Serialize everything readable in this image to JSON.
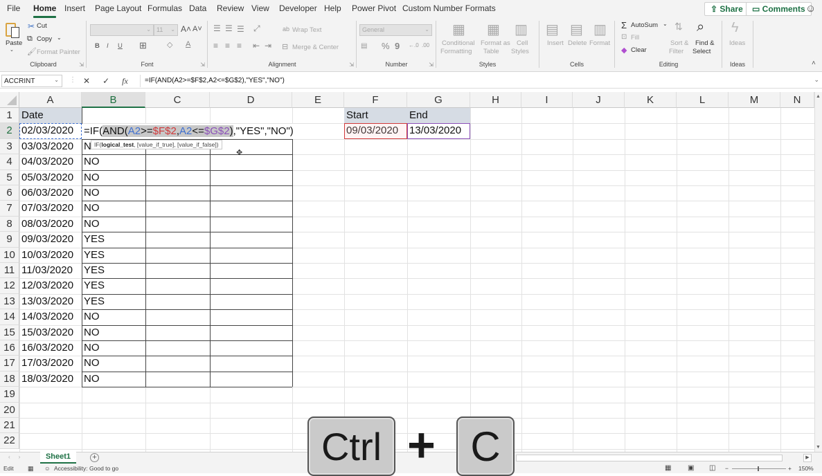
{
  "menu": {
    "tabs": [
      "File",
      "Home",
      "Insert",
      "Page Layout",
      "Formulas",
      "Data",
      "Review",
      "View",
      "Developer",
      "Help",
      "Power Pivot",
      "Custom Number Formats"
    ],
    "active": "Home",
    "share": "Share",
    "comments": "Comments"
  },
  "ribbon": {
    "clipboard": {
      "label": "Clipboard",
      "paste": "Paste",
      "cut": "Cut",
      "copy": "Copy",
      "format_painter": "Format Painter"
    },
    "font": {
      "label": "Font",
      "font_name": "",
      "font_size": "11",
      "bold": "B",
      "italic": "I",
      "underline": "U"
    },
    "alignment": {
      "label": "Alignment",
      "wrap_text": "Wrap Text",
      "merge_center": "Merge & Center"
    },
    "number": {
      "label": "Number",
      "format": "General",
      "percent": "%",
      "comma": "9"
    },
    "styles": {
      "label": "Styles",
      "conditional_formatting": [
        "Conditional",
        "Formatting"
      ],
      "format_as_table": [
        "Format as",
        "Table"
      ],
      "cell_styles": [
        "Cell",
        "Styles"
      ]
    },
    "cells": {
      "label": "Cells",
      "insert": "Insert",
      "delete": "Delete",
      "format": "Format"
    },
    "editing": {
      "label": "Editing",
      "autosum": "AutoSum",
      "fill": "Fill",
      "clear": "Clear",
      "sort_filter": [
        "Sort &",
        "Filter"
      ],
      "find_select": [
        "Find &",
        "Select"
      ]
    },
    "ideas": {
      "label": "Ideas",
      "ideas": "Ideas"
    }
  },
  "formula_bar": {
    "name_box": "ACCRINT",
    "formula": "=IF(AND(A2>=$F$2,A2<=$G$2),\"YES\",\"NO\")"
  },
  "grid": {
    "columns": [
      "A",
      "B",
      "C",
      "D",
      "E",
      "F",
      "G",
      "H",
      "I",
      "J",
      "K",
      "L",
      "M",
      "N"
    ],
    "rows": [
      "1",
      "2",
      "3",
      "4",
      "5",
      "6",
      "7",
      "8",
      "9",
      "10",
      "11",
      "12",
      "13",
      "14",
      "15",
      "16",
      "17",
      "18",
      "19",
      "20",
      "21",
      "22"
    ],
    "selected_column": "B",
    "selected_row": "2",
    "header_a": "Date",
    "dates": [
      "02/03/2020",
      "03/03/2020",
      "04/03/2020",
      "05/03/2020",
      "06/03/2020",
      "07/03/2020",
      "08/03/2020",
      "09/03/2020",
      "10/03/2020",
      "11/03/2020",
      "12/03/2020",
      "13/03/2020",
      "14/03/2020",
      "15/03/2020",
      "16/03/2020",
      "17/03/2020",
      "18/03/2020"
    ],
    "results": [
      "",
      "N",
      "NO",
      "NO",
      "NO",
      "NO",
      "NO",
      "YES",
      "YES",
      "YES",
      "YES",
      "YES",
      "NO",
      "NO",
      "NO",
      "NO",
      "NO"
    ],
    "start_label": "Start",
    "end_label": "End",
    "start_value": "09/03/2020",
    "end_value": "13/03/2020",
    "editing_formula": {
      "prefix": "=IF(",
      "and": "AND(",
      "ref_a1": "A2",
      "op1": ">=",
      "ref_f": "$F$2",
      "comma1": ",",
      "ref_a2": "A2",
      "op2": "<=",
      "ref_g": "$G$2",
      "close": ")",
      "suffix": ",\"YES\",\"NO\")"
    },
    "tooltip": {
      "fn": "IF(",
      "arg1": "logical_test",
      "rest": ", [value_if_true], [value_if_false])"
    }
  },
  "sheets": {
    "tabs": [
      "Sheet1"
    ]
  },
  "status": {
    "mode": "Edit",
    "accessibility": "Accessibility: Good to go",
    "zoom": "150%"
  },
  "overlay": {
    "key1": "Ctrl",
    "plus": "+",
    "key2": "C"
  }
}
